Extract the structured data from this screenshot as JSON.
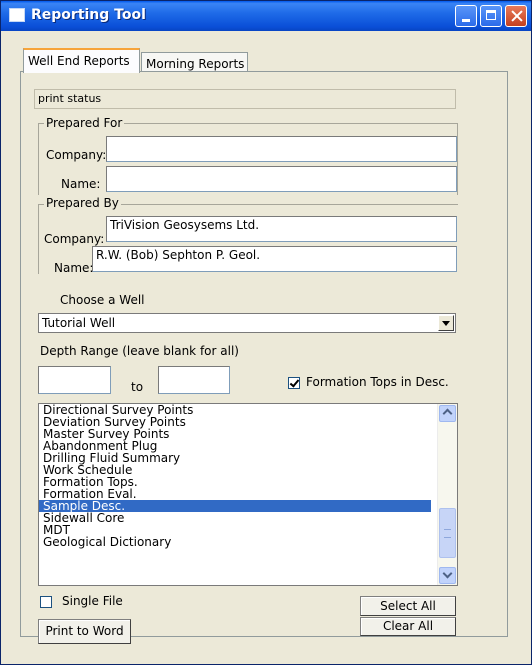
{
  "window": {
    "title": "Reporting Tool"
  },
  "tabs": [
    {
      "label": "Well End Reports",
      "active": true
    },
    {
      "label": "Morning Reports",
      "active": false
    }
  ],
  "status": {
    "text": "print status"
  },
  "prepared_for": {
    "legend": "Prepared For",
    "company_label": "Company:",
    "company_value": "",
    "name_label": "Name:",
    "name_value": ""
  },
  "prepared_by": {
    "legend": "Prepared By",
    "company_label": "Company:",
    "company_value": "TriVision Geosysems Ltd.",
    "name_label": "Name:",
    "name_value": "R.W. (Bob) Sephton P. Geol."
  },
  "well": {
    "label": "Choose a Well",
    "selected": "Tutorial Well"
  },
  "depth": {
    "label": "Depth Range (leave blank for all)",
    "from": "",
    "to_label": "to",
    "to": ""
  },
  "formation_tops": {
    "label": "Formation Tops in Desc.",
    "checked": true
  },
  "report_list": {
    "items": [
      "Directional Survey Points",
      "Deviation Survey Points",
      "Master Survey Points",
      "Abandonment Plug",
      "Drilling Fluid Summary",
      "Work Schedule",
      "Formation Tops.",
      "Formation Eval.",
      "Sample Desc.",
      "Sidewall Core",
      "MDT",
      "Geological Dictionary"
    ],
    "selected_index": 8
  },
  "single_file": {
    "label": "Single File",
    "checked": false
  },
  "buttons": {
    "select_all": "Select All",
    "clear_all": "Clear All",
    "print_to_word": "Print to Word"
  },
  "colors": {
    "titlebar": "#0a4fd8",
    "selection": "#316ac5",
    "background": "#ece9d8"
  }
}
